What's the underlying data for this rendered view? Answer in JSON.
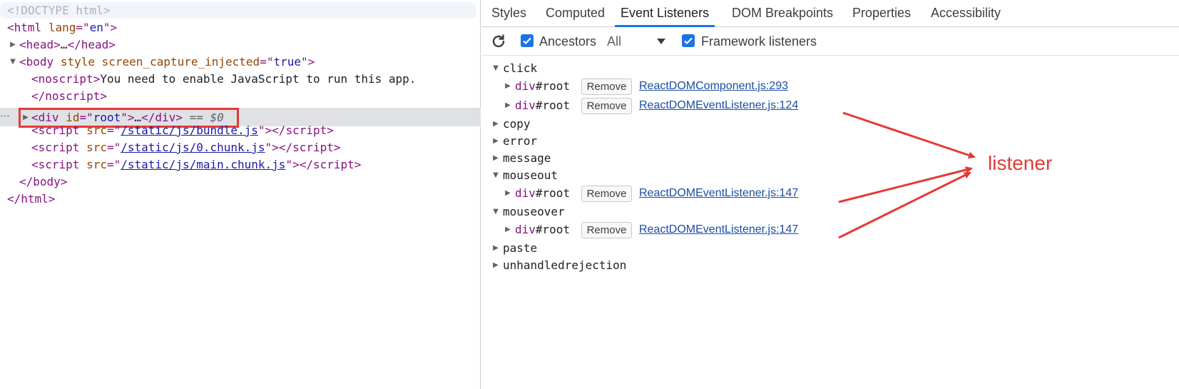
{
  "elements_pane": {
    "doctype": "<!DOCTYPE html>",
    "html_open": {
      "tag": "html",
      "attr": "lang",
      "value": "en"
    },
    "head": {
      "open": "<head>",
      "ellipsis": "…",
      "close": "</head>"
    },
    "body_open": {
      "tag": "body",
      "attr1": "style",
      "attr2": "screen_capture_injected",
      "value2": "true"
    },
    "noscript": {
      "open": "<noscript>",
      "text": "You need to enable JavaScript to run this app.",
      "close": "</noscript>"
    },
    "root_div": {
      "tag": "div",
      "attr": "id",
      "value": "root",
      "ellipsis": "…",
      "close": "</div>",
      "marker": "== $0"
    },
    "scripts": [
      {
        "src": "/static/js/bundle.js"
      },
      {
        "src": "/static/js/0.chunk.js"
      },
      {
        "src": "/static/js/main.chunk.js"
      }
    ],
    "body_close": "</body>",
    "html_close": "</html>",
    "selected_dots": "⋯"
  },
  "sidebar": {
    "tabs": [
      "Styles",
      "Computed",
      "Event Listeners",
      "DOM Breakpoints",
      "Properties",
      "Accessibility"
    ],
    "active_tab": "Event Listeners",
    "toolbar": {
      "ancestors_label": "Ancestors",
      "ancestors_checked": true,
      "filter_value": "All",
      "framework_label": "Framework listeners",
      "framework_checked": true
    },
    "remove_label": "Remove",
    "events": [
      {
        "name": "click",
        "expanded": true,
        "listeners": [
          {
            "node": "div",
            "id": "#root",
            "source": "ReactDOMComponent.js:293"
          },
          {
            "node": "div",
            "id": "#root",
            "source": "ReactDOMEventListener.js:124"
          }
        ]
      },
      {
        "name": "copy",
        "expanded": false
      },
      {
        "name": "error",
        "expanded": false
      },
      {
        "name": "message",
        "expanded": false
      },
      {
        "name": "mouseout",
        "expanded": true,
        "listeners": [
          {
            "node": "div",
            "id": "#root",
            "source": "ReactDOMEventListener.js:147"
          }
        ]
      },
      {
        "name": "mouseover",
        "expanded": true,
        "listeners": [
          {
            "node": "div",
            "id": "#root",
            "source": "ReactDOMEventListener.js:147"
          }
        ]
      },
      {
        "name": "paste",
        "expanded": false
      },
      {
        "name": "unhandledrejection",
        "expanded": false
      }
    ]
  },
  "annotation": {
    "label": "listener",
    "color": "#e53935"
  },
  "colors": {
    "tag": "#881280",
    "attr": "#994500",
    "value": "#1a1aa6",
    "accent": "#1a73e8"
  }
}
